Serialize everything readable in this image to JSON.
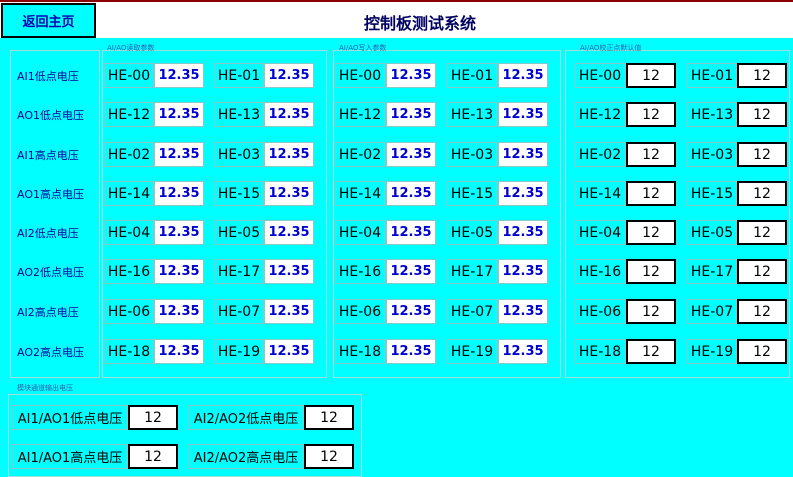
{
  "header": {
    "home_button": "返回主页",
    "title": "控制板测试系统"
  },
  "groups": {
    "read": "AI/AO读取参数",
    "write": "AI/AO写入参数",
    "calib": "AI/AO校正点默认值",
    "output": "模块通道输出电压"
  },
  "row_labels": [
    "AI1低点电压",
    "AO1低点电压",
    "AI1高点电压",
    "AO1高点电压",
    "AI2低点电压",
    "AO2低点电压",
    "AI2高点电压",
    "AO2高点电压"
  ],
  "rows": [
    {
      "left": "HE-00",
      "right": "HE-01"
    },
    {
      "left": "HE-12",
      "right": "HE-13"
    },
    {
      "left": "HE-02",
      "right": "HE-03"
    },
    {
      "left": "HE-14",
      "right": "HE-15"
    },
    {
      "left": "HE-04",
      "right": "HE-05"
    },
    {
      "left": "HE-16",
      "right": "HE-17"
    },
    {
      "left": "HE-06",
      "right": "HE-07"
    },
    {
      "left": "HE-18",
      "right": "HE-19"
    }
  ],
  "read_value": "12.35",
  "write_value": "12.35",
  "calib_value": "12",
  "output_items": [
    {
      "label": "AI1/AO1低点电压",
      "value": "12"
    },
    {
      "label": "AI2/AO2低点电压",
      "value": "12"
    },
    {
      "label": "AI1/AO1高点电压",
      "value": "12"
    },
    {
      "label": "AI2/AO2高点电压",
      "value": "12"
    }
  ]
}
